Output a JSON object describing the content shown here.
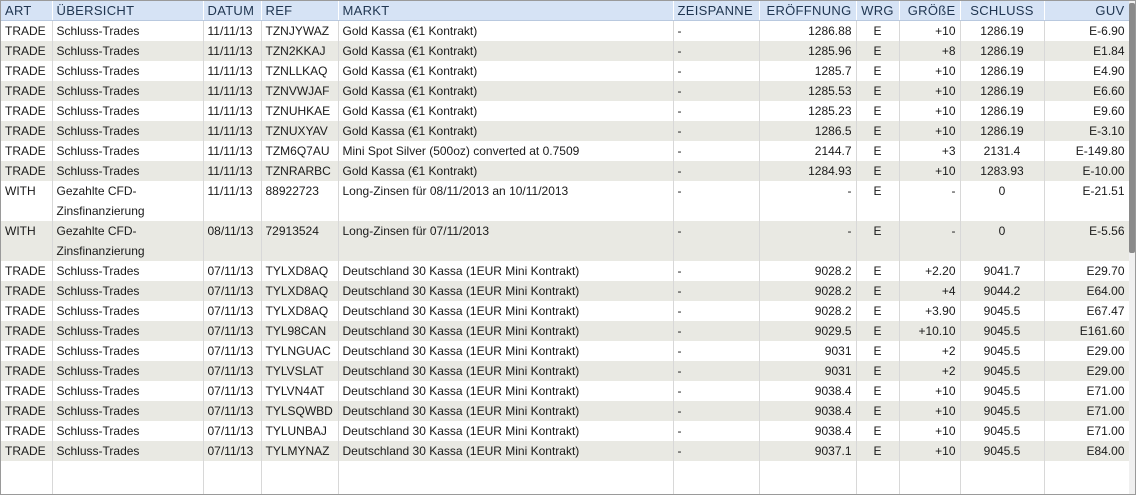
{
  "headers": [
    "ART",
    "ÜBERSICHT",
    "DATUM",
    "REF",
    "MARKT",
    "ZEISPANNE",
    "ERÖFFNUNG",
    "WRG",
    "GRÖßE",
    "SCHLUSS",
    "GUV"
  ],
  "rows": [
    [
      "TRADE",
      "Schluss-Trades",
      "11/11/13",
      "TZNJYWAZ",
      "Gold Kassa (€1 Kontrakt)",
      "-",
      "1286.88",
      "E",
      "+10",
      "1286.19",
      "E-6.90"
    ],
    [
      "TRADE",
      "Schluss-Trades",
      "11/11/13",
      "TZN2KKAJ",
      "Gold Kassa (€1 Kontrakt)",
      "-",
      "1285.96",
      "E",
      "+8",
      "1286.19",
      "E1.84"
    ],
    [
      "TRADE",
      "Schluss-Trades",
      "11/11/13",
      "TZNLLKAQ",
      "Gold Kassa (€1 Kontrakt)",
      "-",
      "1285.7",
      "E",
      "+10",
      "1286.19",
      "E4.90"
    ],
    [
      "TRADE",
      "Schluss-Trades",
      "11/11/13",
      "TZNVWJAF",
      "Gold Kassa (€1 Kontrakt)",
      "-",
      "1285.53",
      "E",
      "+10",
      "1286.19",
      "E6.60"
    ],
    [
      "TRADE",
      "Schluss-Trades",
      "11/11/13",
      "TZNUHKAE",
      "Gold Kassa (€1 Kontrakt)",
      "-",
      "1285.23",
      "E",
      "+10",
      "1286.19",
      "E9.60"
    ],
    [
      "TRADE",
      "Schluss-Trades",
      "11/11/13",
      "TZNUXYAV",
      "Gold Kassa (€1 Kontrakt)",
      "-",
      "1286.5",
      "E",
      "+10",
      "1286.19",
      "E-3.10"
    ],
    [
      "TRADE",
      "Schluss-Trades",
      "11/11/13",
      "TZM6Q7AU",
      "Mini Spot Silver (500oz) converted at 0.7509",
      "-",
      "2144.7",
      "E",
      "+3",
      "2131.4",
      "E-149.80"
    ],
    [
      "TRADE",
      "Schluss-Trades",
      "11/11/13",
      "TZNRARBC",
      "Gold Kassa (€1 Kontrakt)",
      "-",
      "1284.93",
      "E",
      "+10",
      "1283.93",
      "E-10.00"
    ],
    [
      "WITH",
      "Gezahlte CFD-Zinsfinanzierung",
      "11/11/13",
      "88922723",
      "Long-Zinsen für 08/11/2013 an 10/11/2013",
      "-",
      "-",
      "E",
      "-",
      "0",
      "E-21.51"
    ],
    [
      "WITH",
      "Gezahlte CFD-Zinsfinanzierung",
      "08/11/13",
      "72913524",
      "Long-Zinsen für 07/11/2013",
      "-",
      "-",
      "E",
      "-",
      "0",
      "E-5.56"
    ],
    [
      "TRADE",
      "Schluss-Trades",
      "07/11/13",
      "TYLXD8AQ",
      "Deutschland 30 Kassa (1EUR Mini Kontrakt)",
      "-",
      "9028.2",
      "E",
      "+2.20",
      "9041.7",
      "E29.70"
    ],
    [
      "TRADE",
      "Schluss-Trades",
      "07/11/13",
      "TYLXD8AQ",
      "Deutschland 30 Kassa (1EUR Mini Kontrakt)",
      "-",
      "9028.2",
      "E",
      "+4",
      "9044.2",
      "E64.00"
    ],
    [
      "TRADE",
      "Schluss-Trades",
      "07/11/13",
      "TYLXD8AQ",
      "Deutschland 30 Kassa (1EUR Mini Kontrakt)",
      "-",
      "9028.2",
      "E",
      "+3.90",
      "9045.5",
      "E67.47"
    ],
    [
      "TRADE",
      "Schluss-Trades",
      "07/11/13",
      "TYL98CAN",
      "Deutschland 30 Kassa (1EUR Mini Kontrakt)",
      "-",
      "9029.5",
      "E",
      "+10.10",
      "9045.5",
      "E161.60"
    ],
    [
      "TRADE",
      "Schluss-Trades",
      "07/11/13",
      "TYLNGUAC",
      "Deutschland 30 Kassa (1EUR Mini Kontrakt)",
      "-",
      "9031",
      "E",
      "+2",
      "9045.5",
      "E29.00"
    ],
    [
      "TRADE",
      "Schluss-Trades",
      "07/11/13",
      "TYLVSLAT",
      "Deutschland 30 Kassa (1EUR Mini Kontrakt)",
      "-",
      "9031",
      "E",
      "+2",
      "9045.5",
      "E29.00"
    ],
    [
      "TRADE",
      "Schluss-Trades",
      "07/11/13",
      "TYLVN4AT",
      "Deutschland 30 Kassa (1EUR Mini Kontrakt)",
      "-",
      "9038.4",
      "E",
      "+10",
      "9045.5",
      "E71.00"
    ],
    [
      "TRADE",
      "Schluss-Trades",
      "07/11/13",
      "TYLSQWBD",
      "Deutschland 30 Kassa (1EUR Mini Kontrakt)",
      "-",
      "9038.4",
      "E",
      "+10",
      "9045.5",
      "E71.00"
    ],
    [
      "TRADE",
      "Schluss-Trades",
      "07/11/13",
      "TYLUNBAJ",
      "Deutschland 30 Kassa (1EUR Mini Kontrakt)",
      "-",
      "9038.4",
      "E",
      "+10",
      "9045.5",
      "E71.00"
    ],
    [
      "TRADE",
      "Schluss-Trades",
      "07/11/13",
      "TYLMYNAZ",
      "Deutschland 30 Kassa (1EUR Mini Kontrakt)",
      "-",
      "9037.1",
      "E",
      "+10",
      "9045.5",
      "E84.00"
    ]
  ]
}
